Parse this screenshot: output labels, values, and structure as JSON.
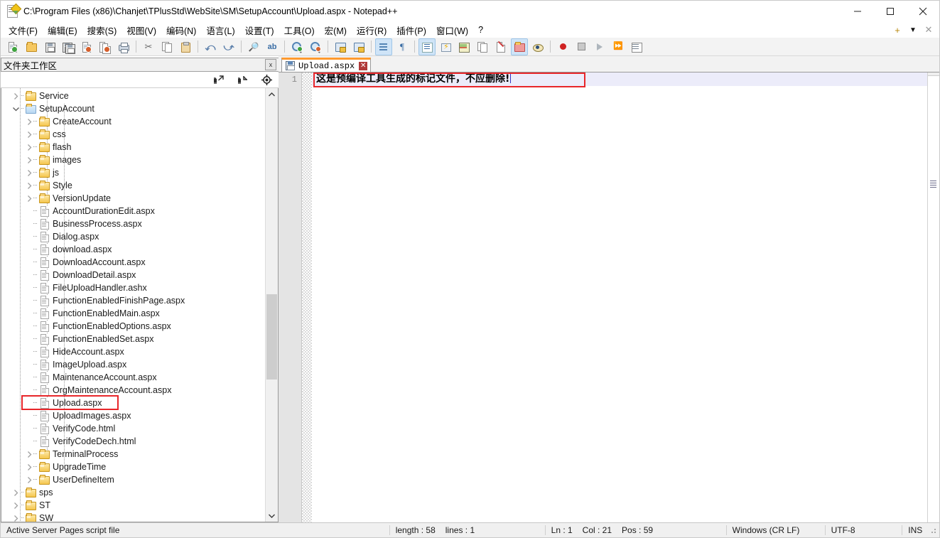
{
  "window": {
    "title": "C:\\Program Files (x86)\\Chanjet\\TPlusStd\\WebSite\\SM\\SetupAccount\\Upload.aspx - Notepad++",
    "icon": "notepad-plus-plus-icon",
    "minimize": "–",
    "maximize": "□",
    "close": "✕"
  },
  "menu": {
    "items": [
      {
        "label": "文件(F)",
        "name": "menu-file"
      },
      {
        "label": "编辑(E)",
        "name": "menu-edit"
      },
      {
        "label": "搜索(S)",
        "name": "menu-search"
      },
      {
        "label": "视图(V)",
        "name": "menu-view"
      },
      {
        "label": "编码(N)",
        "name": "menu-encoding"
      },
      {
        "label": "语言(L)",
        "name": "menu-language"
      },
      {
        "label": "设置(T)",
        "name": "menu-settings"
      },
      {
        "label": "工具(O)",
        "name": "menu-tools"
      },
      {
        "label": "宏(M)",
        "name": "menu-macro"
      },
      {
        "label": "运行(R)",
        "name": "menu-run"
      },
      {
        "label": "插件(P)",
        "name": "menu-plugins"
      },
      {
        "label": "窗口(W)",
        "name": "menu-window"
      },
      {
        "label": "?",
        "name": "menu-help"
      }
    ],
    "right": {
      "add": "+",
      "dropdown": "▼",
      "close": "✕"
    }
  },
  "toolbar": {
    "buttons": [
      "new-file-icon",
      "open-file-icon",
      "save-icon",
      "save-all-icon",
      "close-file-icon",
      "close-all-icon",
      "print-icon",
      "cut-icon",
      "copy-icon",
      "paste-icon",
      "undo-icon",
      "redo-icon",
      "find-icon",
      "replace-icon",
      "zoom-in-icon",
      "zoom-out-icon",
      "sync-vertical-scroll-icon",
      "sync-horizontal-scroll-icon",
      "word-wrap-icon",
      "show-all-characters-icon",
      "indent-guide-icon",
      "user-defined-language-icon",
      "document-map-icon",
      "function-list-icon",
      "document-switcher-icon",
      "folder-as-workspace-icon",
      "monitoring-icon",
      "record-macro-icon",
      "stop-recording-icon",
      "play-macro-icon",
      "run-macro-multiple-icon",
      "save-macro-icon"
    ]
  },
  "panel": {
    "caption": "文件夹工作区",
    "close_label": "x",
    "toolbar_buttons": [
      "expand-all-icon",
      "collapse-all-icon",
      "locate-current-file-icon"
    ]
  },
  "tree": {
    "items": [
      {
        "label": "Service",
        "type": "folder",
        "depth": 1,
        "expanded": false
      },
      {
        "label": "SetupAccount",
        "type": "folder-open",
        "depth": 1,
        "expanded": true
      },
      {
        "label": "CreateAccount",
        "type": "folder",
        "depth": 2,
        "expanded": false
      },
      {
        "label": "css",
        "type": "folder",
        "depth": 2,
        "expanded": false
      },
      {
        "label": "flash",
        "type": "folder",
        "depth": 2,
        "expanded": false
      },
      {
        "label": "images",
        "type": "folder",
        "depth": 2,
        "expanded": false
      },
      {
        "label": "js",
        "type": "folder",
        "depth": 2,
        "expanded": false
      },
      {
        "label": "Style",
        "type": "folder",
        "depth": 2,
        "expanded": false
      },
      {
        "label": "VersionUpdate",
        "type": "folder",
        "depth": 2,
        "expanded": false
      },
      {
        "label": "AccountDurationEdit.aspx",
        "type": "file",
        "depth": 2
      },
      {
        "label": "BusinessProcess.aspx",
        "type": "file",
        "depth": 2
      },
      {
        "label": "Dialog.aspx",
        "type": "file",
        "depth": 2
      },
      {
        "label": "download.aspx",
        "type": "file",
        "depth": 2
      },
      {
        "label": "DownloadAccount.aspx",
        "type": "file",
        "depth": 2
      },
      {
        "label": "DownloadDetail.aspx",
        "type": "file",
        "depth": 2
      },
      {
        "label": "FileUploadHandler.ashx",
        "type": "file",
        "depth": 2
      },
      {
        "label": "FunctionEnabledFinishPage.aspx",
        "type": "file",
        "depth": 2
      },
      {
        "label": "FunctionEnabledMain.aspx",
        "type": "file",
        "depth": 2
      },
      {
        "label": "FunctionEnabledOptions.aspx",
        "type": "file",
        "depth": 2
      },
      {
        "label": "FunctionEnabledSet.aspx",
        "type": "file",
        "depth": 2
      },
      {
        "label": "HideAccount.aspx",
        "type": "file",
        "depth": 2
      },
      {
        "label": "ImageUpload.aspx",
        "type": "file",
        "depth": 2
      },
      {
        "label": "MaintenanceAccount.aspx",
        "type": "file",
        "depth": 2
      },
      {
        "label": "OrgMaintenanceAccount.aspx",
        "type": "file",
        "depth": 2
      },
      {
        "label": "Upload.aspx",
        "type": "file",
        "depth": 2,
        "highlighted": true
      },
      {
        "label": "UploadImages.aspx",
        "type": "file",
        "depth": 2
      },
      {
        "label": "VerifyCode.html",
        "type": "file",
        "depth": 2
      },
      {
        "label": "VerifyCodeDech.html",
        "type": "file",
        "depth": 2
      },
      {
        "label": "TerminalProcess",
        "type": "folder",
        "depth": 2,
        "expanded": false
      },
      {
        "label": "UpgradeTime",
        "type": "folder",
        "depth": 2,
        "expanded": false
      },
      {
        "label": "UserDefineItem",
        "type": "folder",
        "depth": 2,
        "expanded": false
      },
      {
        "label": "sps",
        "type": "folder",
        "depth": 1,
        "expanded": false
      },
      {
        "label": "ST",
        "type": "folder",
        "depth": 1,
        "expanded": false
      },
      {
        "label": "SW",
        "type": "folder",
        "depth": 1,
        "expanded": false
      }
    ],
    "scroll_up": "⌃",
    "scroll_down": "⌄"
  },
  "tabs": [
    {
      "label": "Upload.aspx",
      "icon": "saved-file-icon",
      "close": "✕",
      "active": true
    }
  ],
  "editor": {
    "lines": [
      {
        "number": "1",
        "text": "这是预编译工具生成的标记文件，不应删除!"
      }
    ]
  },
  "status": {
    "file_type": "Active Server Pages script file",
    "length": "length : 58",
    "lines": "lines : 1",
    "ln": "Ln : 1",
    "col": "Col : 21",
    "pos": "Pos : 59",
    "eol": "Windows (CR LF)",
    "encoding": "UTF-8",
    "insert_mode": "INS"
  },
  "colors": {
    "highlight_red": "#e8262a",
    "tab_accent": "#ff9a2e",
    "selection": "#ececfa",
    "folder": "#f5c64e"
  }
}
